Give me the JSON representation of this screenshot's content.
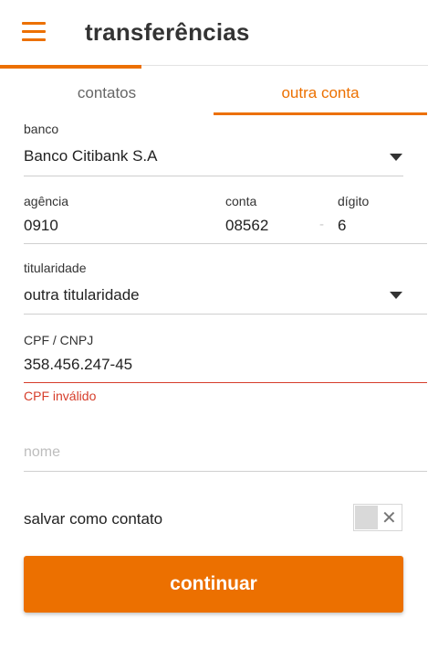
{
  "header": {
    "title": "transferências"
  },
  "tabs": [
    {
      "label": "contatos"
    },
    {
      "label": "outra conta"
    }
  ],
  "form": {
    "banco": {
      "label": "banco",
      "value": "Banco Citibank S.A"
    },
    "agencia": {
      "label": "agência",
      "value": "0910"
    },
    "conta": {
      "label": "conta",
      "value": "08562",
      "separator": "-"
    },
    "digito": {
      "label": "dígito",
      "value": "6"
    },
    "titularidade": {
      "label": "titularidade",
      "value": "outra titularidade"
    },
    "cpf": {
      "label": "CPF / CNPJ",
      "value": "358.456.247-45",
      "error": "CPF inválido"
    },
    "nome": {
      "placeholder": "nome"
    },
    "salvar": {
      "label": "salvar como contato",
      "toggle_icon": "✕"
    }
  },
  "actions": {
    "continue_label": "continuar"
  },
  "colors": {
    "accent": "#ec7000",
    "error": "#d63d2a"
  }
}
